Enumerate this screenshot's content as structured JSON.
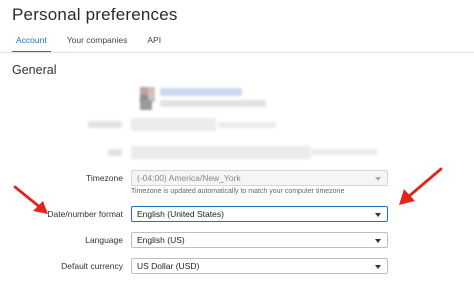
{
  "page_title": "Personal preferences",
  "tabs": [
    {
      "label": "Account",
      "active": true
    },
    {
      "label": "Your companies",
      "active": false
    },
    {
      "label": "API",
      "active": false
    }
  ],
  "section_title": "General",
  "form": {
    "timezone": {
      "label": "Timezone",
      "value": "(-04:00) America/New_York",
      "hint": "Timezone is updated automatically to match your computer timezone"
    },
    "date_format": {
      "label": "Date/number format",
      "value": "English (United States)"
    },
    "language": {
      "label": "Language",
      "value": "English (US)"
    },
    "currency": {
      "label": "Default currency",
      "value": "US Dollar (USD)"
    }
  },
  "colors": {
    "accent": "#1a73c8",
    "annotation_arrow": "#e0261d"
  }
}
